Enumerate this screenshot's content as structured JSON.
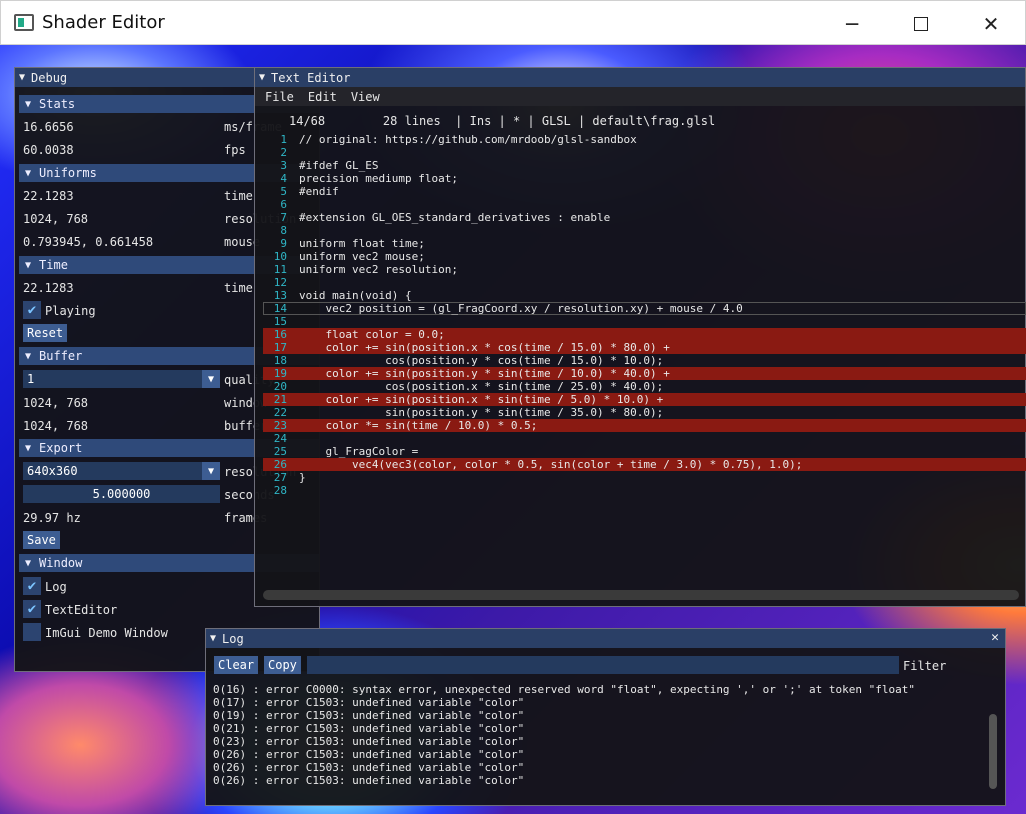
{
  "window": {
    "title": "Shader Editor",
    "minimize_icon": "minimize-icon",
    "maximize_icon": "maximize-icon",
    "close_icon": "close-icon"
  },
  "debug": {
    "title": "Debug",
    "stats": {
      "header": "Stats",
      "rows": [
        {
          "value": "16.6656",
          "label": "ms/frame"
        },
        {
          "value": "60.0038",
          "label": "fps"
        }
      ]
    },
    "uniforms": {
      "header": "Uniforms",
      "rows": [
        {
          "value": "22.1283",
          "label": "time"
        },
        {
          "value": "1024, 768",
          "label": "resolution"
        },
        {
          "value": "0.793945, 0.661458",
          "label": "mouse"
        }
      ]
    },
    "time": {
      "header": "Time",
      "value": "22.1283",
      "label": "time",
      "playing_label": "Playing",
      "reset_label": "Reset"
    },
    "buffer": {
      "header": "Buffer",
      "quality_value": "1",
      "quality_label": "quality",
      "rows": [
        {
          "value": "1024, 768",
          "label": "window"
        },
        {
          "value": "1024, 768",
          "label": "buffer"
        }
      ]
    },
    "export": {
      "header": "Export",
      "resolution_value": "640x360",
      "resolution_label": "resolution",
      "seconds_value": "5.000000",
      "seconds_label": "seconds",
      "frames_value": "29.97 hz",
      "frames_label": "frames",
      "save_label": "Save"
    },
    "windows": {
      "header": "Window",
      "items": [
        {
          "label": "Log",
          "checked": true
        },
        {
          "label": "TextEditor",
          "checked": true
        },
        {
          "label": "ImGui Demo Window",
          "checked": false
        }
      ]
    }
  },
  "editor": {
    "title": "Text Editor",
    "menu": [
      "File",
      "Edit",
      "View"
    ],
    "status": "14/68        28 lines  | Ins | * | GLSL | default\\frag.glsl",
    "lines": [
      {
        "n": "1",
        "t": "// original: https://github.com/mrdoob/glsl-sandbox"
      },
      {
        "n": "2",
        "t": ""
      },
      {
        "n": "3",
        "t": "#ifdef GL_ES"
      },
      {
        "n": "4",
        "t": "precision mediump float;"
      },
      {
        "n": "5",
        "t": "#endif"
      },
      {
        "n": "6",
        "t": ""
      },
      {
        "n": "7",
        "t": "#extension GL_OES_standard_derivatives : enable"
      },
      {
        "n": "8",
        "t": ""
      },
      {
        "n": "9",
        "t": "uniform float time;"
      },
      {
        "n": "10",
        "t": "uniform vec2 mouse;"
      },
      {
        "n": "11",
        "t": "uniform vec2 resolution;"
      },
      {
        "n": "12",
        "t": ""
      },
      {
        "n": "13",
        "t": "void main(void) {"
      },
      {
        "n": "14",
        "t": "    vec2 position = (gl_FragCoord.xy / resolution.xy) + mouse / 4.0"
      },
      {
        "n": "15",
        "t": ""
      },
      {
        "n": "16",
        "t": "    float color = 0.0;"
      },
      {
        "n": "17",
        "t": "    color += sin(position.x * cos(time / 15.0) * 80.0) +"
      },
      {
        "n": "18",
        "t": "             cos(position.y * cos(time / 15.0) * 10.0);"
      },
      {
        "n": "19",
        "t": "    color += sin(position.y * sin(time / 10.0) * 40.0) +"
      },
      {
        "n": "20",
        "t": "             cos(position.x * sin(time / 25.0) * 40.0);"
      },
      {
        "n": "21",
        "t": "    color += sin(position.x * sin(time / 5.0) * 10.0) +"
      },
      {
        "n": "22",
        "t": "             sin(position.y * sin(time / 35.0) * 80.0);"
      },
      {
        "n": "23",
        "t": "    color *= sin(time / 10.0) * 0.5;"
      },
      {
        "n": "24",
        "t": ""
      },
      {
        "n": "25",
        "t": "    gl_FragColor ="
      },
      {
        "n": "26",
        "t": "        vec4(vec3(color, color * 0.5, sin(color + time / 3.0) * 0.75), 1.0);"
      },
      {
        "n": "27",
        "t": "}"
      },
      {
        "n": "28",
        "t": ""
      }
    ],
    "error_lines": [
      16,
      17,
      19,
      21,
      23,
      26
    ],
    "current_line": 14
  },
  "log": {
    "title": "Log",
    "clear_label": "Clear",
    "copy_label": "Copy",
    "filter_label": "Filter",
    "filter_value": "",
    "lines": [
      "0(16) : error C0000: syntax error, unexpected reserved word \"float\", expecting ',' or ';' at token \"float\"",
      "0(17) : error C1503: undefined variable \"color\"",
      "0(19) : error C1503: undefined variable \"color\"",
      "0(21) : error C1503: undefined variable \"color\"",
      "0(23) : error C1503: undefined variable \"color\"",
      "0(26) : error C1503: undefined variable \"color\"",
      "0(26) : error C1503: undefined variable \"color\"",
      "0(26) : error C1503: undefined variable \"color\""
    ]
  }
}
